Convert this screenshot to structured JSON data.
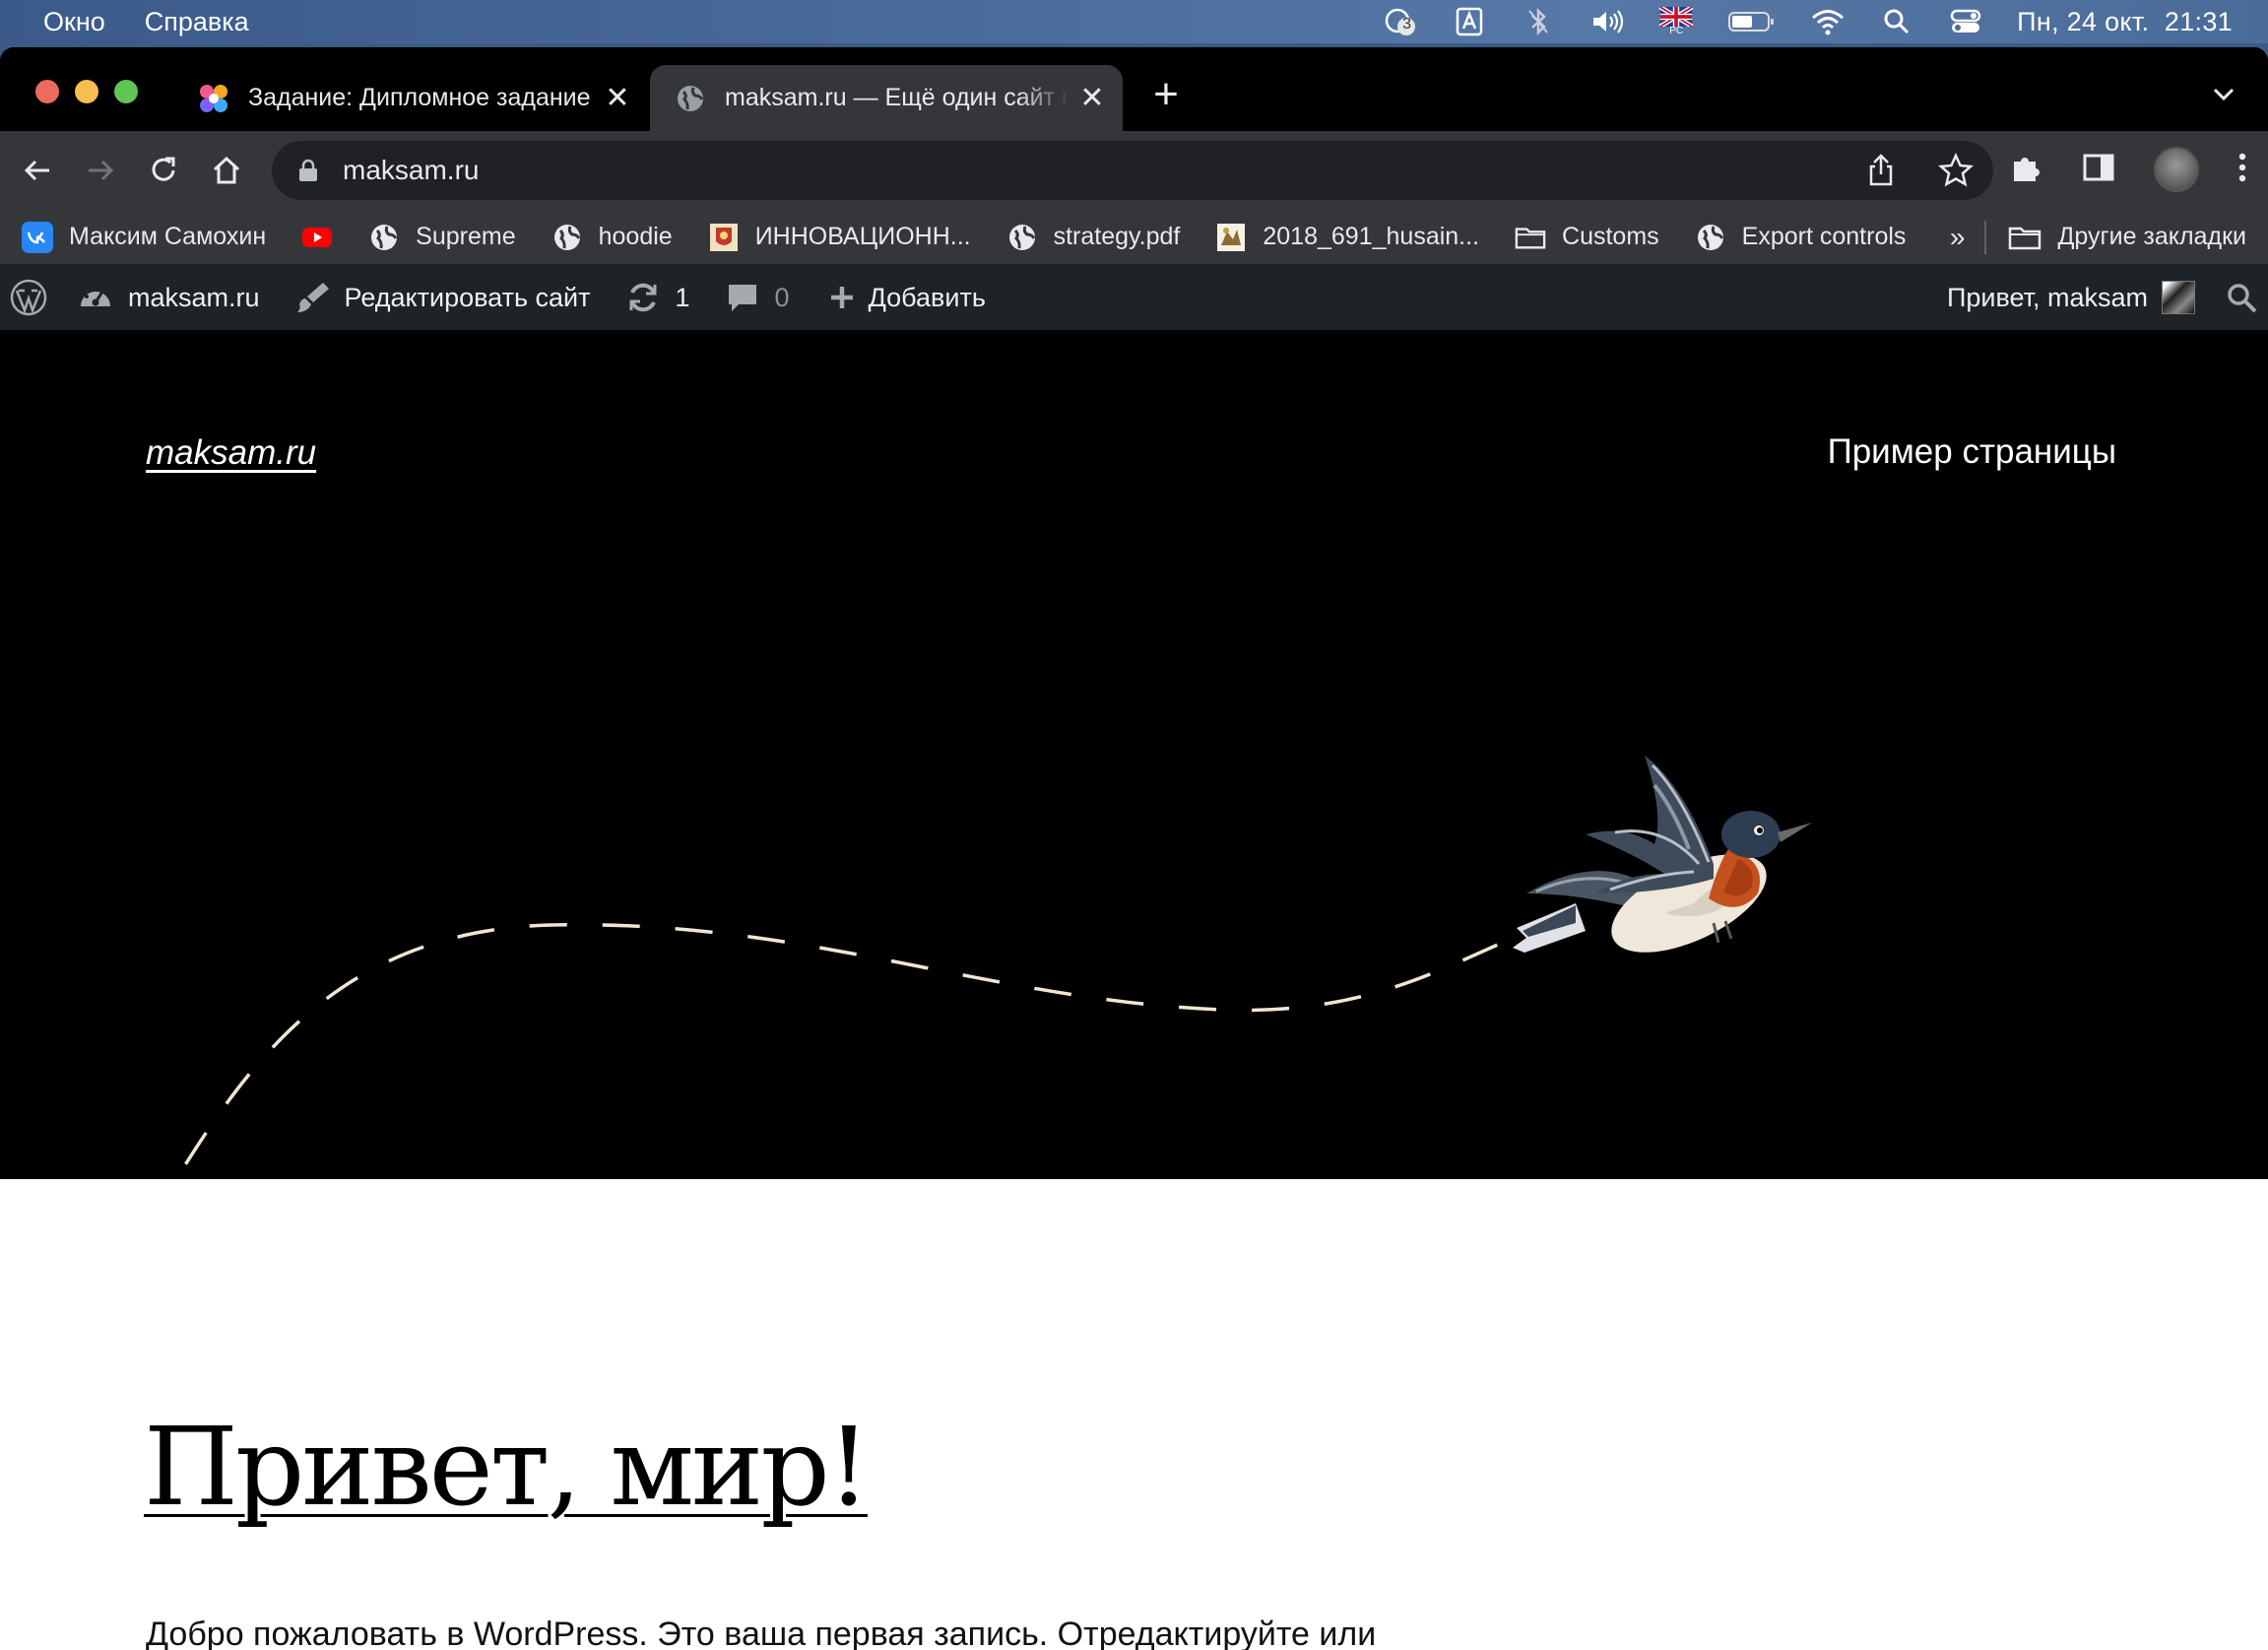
{
  "menubar": {
    "items": [
      "Окно",
      "Справка"
    ],
    "notification_count": "3",
    "keyboard_layout": "PC",
    "clock": "Пн, 24 окт.  21:31"
  },
  "browser": {
    "tabs": [
      {
        "title": "Задание: Дипломное задание",
        "favicon": "colorful-dots-icon",
        "active": false
      },
      {
        "title": "maksam.ru — Ещё один сайт на WordPress",
        "favicon": "globe-icon",
        "active": true
      }
    ],
    "url": "maksam.ru",
    "bookmarks": [
      {
        "label": "Максим Самохин",
        "icon": "vk-icon"
      },
      {
        "label": "",
        "icon": "youtube-icon"
      },
      {
        "label": "Supreme",
        "icon": "globe-icon"
      },
      {
        "label": "hoodie",
        "icon": "globe-icon"
      },
      {
        "label": "ИННОВАЦИОНН...",
        "icon": "emblem-icon"
      },
      {
        "label": "strategy.pdf",
        "icon": "globe-icon"
      },
      {
        "label": "2018_691_husain...",
        "icon": "crest-icon"
      },
      {
        "label": "Customs",
        "icon": "folder-icon"
      },
      {
        "label": "Export controls",
        "icon": "globe-icon"
      }
    ],
    "bookmarks_more": "»",
    "other_bookmarks": "Другие закладки"
  },
  "adminbar": {
    "site": "maksam.ru",
    "edit_site": "Редактировать сайт",
    "updates": "1",
    "comments": "0",
    "add_new": "Добавить",
    "greeting": "Привет, maksam"
  },
  "site": {
    "title": "maksam.ru",
    "nav_item": "Пример страницы",
    "post_title": "Привет, мир!",
    "post_excerpt": "Добро пожаловать в WordPress. Это ваша первая запись. Отредактируйте или удалите ее, затем начинайте создавать!"
  },
  "colors": {
    "admin_bar": "#1d2327",
    "hero_background": "#000000",
    "dash_line": "#f2e6d2",
    "tab_active": "#35363a"
  }
}
